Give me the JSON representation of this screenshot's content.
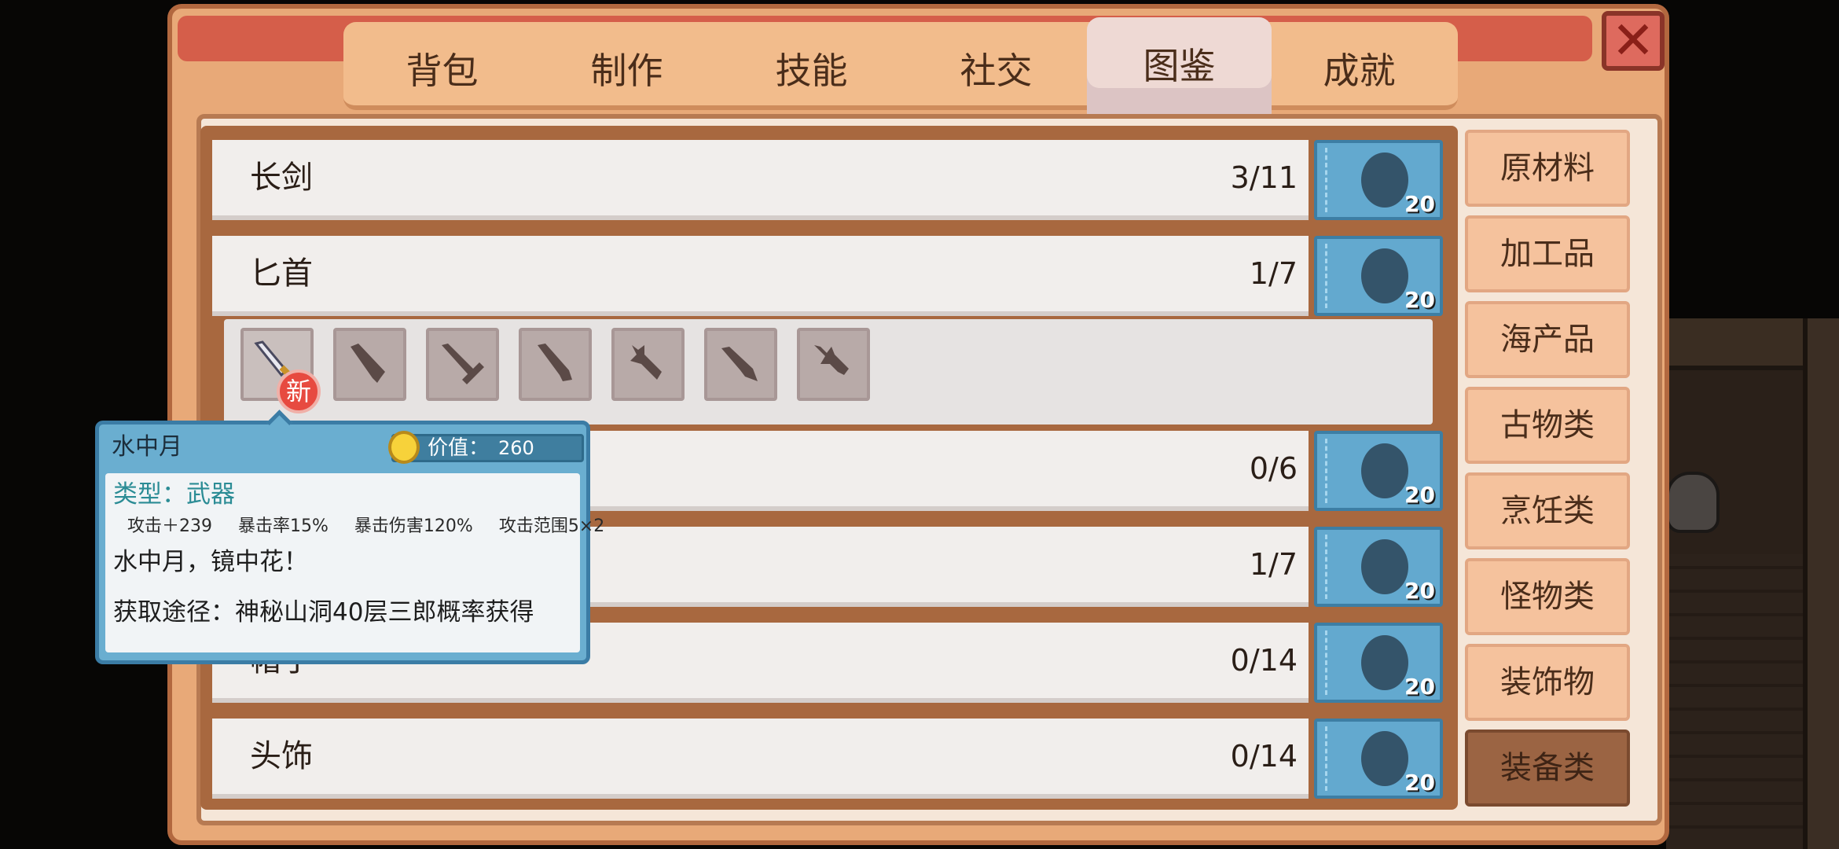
{
  "window": {
    "close_icon": "close-x-icon"
  },
  "tabs": [
    {
      "label": "背包"
    },
    {
      "label": "制作"
    },
    {
      "label": "技能"
    },
    {
      "label": "社交"
    },
    {
      "label": "图鉴",
      "active": true
    },
    {
      "label": "成就"
    }
  ],
  "categories": [
    {
      "label": "原材料"
    },
    {
      "label": "加工品"
    },
    {
      "label": "海产品"
    },
    {
      "label": "古物类"
    },
    {
      "label": "烹饪类"
    },
    {
      "label": "怪物类"
    },
    {
      "label": "装饰物"
    },
    {
      "label": "装备类",
      "active": true
    }
  ],
  "rows": [
    {
      "label": "长剑",
      "count": "3/11",
      "reward": "20"
    },
    {
      "label": "匕首",
      "count": "1/7",
      "reward": "20"
    },
    {
      "label": "",
      "count": "0/6",
      "reward": "20"
    },
    {
      "label": "",
      "count": "1/7",
      "reward": "20"
    },
    {
      "label": "帽子",
      "count": "0/14",
      "reward": "20"
    },
    {
      "label": "头饰",
      "count": "0/14",
      "reward": "20"
    }
  ],
  "items": {
    "new_badge": "新",
    "icons": [
      "dagger-icon",
      "dagger-silhouette-icon",
      "dagger-silhouette-icon",
      "dagger-silhouette-icon",
      "dagger-silhouette-icon",
      "dagger-silhouette-icon",
      "dagger-silhouette-icon"
    ]
  },
  "tooltip": {
    "name": "水中月",
    "value_label": "价值：",
    "value": "260",
    "type": "类型：武器",
    "stats": [
      "攻击＋239",
      "暴击率15%",
      "暴击伤害120%",
      "攻击范围5×2"
    ],
    "desc": "水中月，镜中花！",
    "source": "获取途径：神秘山洞40层三郎概率获得"
  },
  "colors": {
    "frame": "#e8a978",
    "tab": "#f2bc8c",
    "reward": "#63a9cf",
    "tooltip": "#6aaed0",
    "category": "#f5c29d",
    "category_active": "#9b6443"
  }
}
